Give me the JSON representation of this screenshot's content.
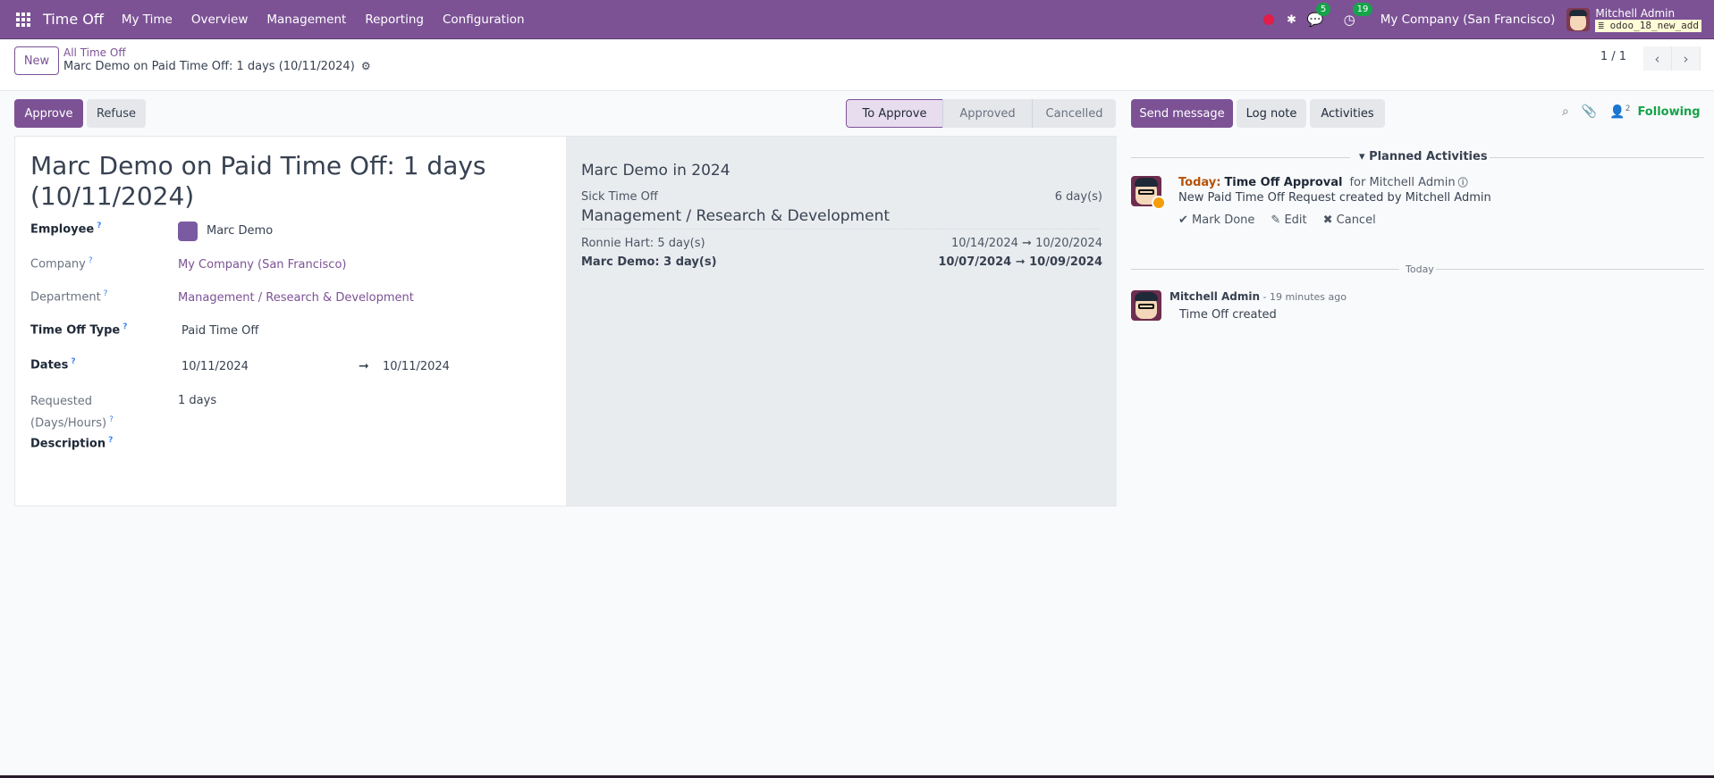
{
  "topbar": {
    "app_title": "Time Off",
    "menu": [
      "My Time",
      "Overview",
      "Management",
      "Reporting",
      "Configuration"
    ],
    "messages_badge": "5",
    "activities_badge": "19",
    "company": "My Company (San Francisco)",
    "user_name": "Mitchell Admin",
    "database": "odoo_18_new_add",
    "icons": {
      "apps": "apps-grid-icon",
      "record": "record-dot-icon",
      "debug": "bug-icon",
      "messages": "chat-icon",
      "activities": "clock-icon"
    }
  },
  "control": {
    "new_label": "New",
    "breadcrumb_parent": "All Time Off",
    "breadcrumb_current": "Marc Demo on Paid Time Off: 1 days (10/11/2024)",
    "pager": "1 / 1",
    "prev_icon": "‹",
    "next_icon": "›"
  },
  "actions": {
    "approve": "Approve",
    "refuse": "Refuse"
  },
  "statusbar": {
    "stages": [
      "To Approve",
      "Approved",
      "Cancelled"
    ],
    "active": "To Approve"
  },
  "form": {
    "title_line1": "Marc Demo on Paid Time Off: 1 days",
    "title_line2": "(10/11/2024)",
    "help_mark": "?",
    "fields": {
      "employee": {
        "label": "Employee",
        "value": "Marc Demo"
      },
      "company": {
        "label": "Company",
        "value": "My Company (San Francisco)"
      },
      "department": {
        "label": "Department",
        "value": "Management / Research & Development"
      },
      "time_off_type": {
        "label": "Time Off Type",
        "value": "Paid Time Off"
      },
      "dates": {
        "label": "Dates",
        "from": "10/11/2024",
        "to": "10/11/2024",
        "arrow": "➞"
      },
      "requested": {
        "label_line1": "Requested",
        "label_line2": "(Days/Hours)",
        "value": "1 days"
      },
      "description": {
        "label": "Description"
      }
    }
  },
  "summary": {
    "title": "Marc Demo in 2024",
    "allocations": [
      {
        "type": "Sick Time Off",
        "amount": "6 day(s)"
      }
    ],
    "department_title": "Management / Research & Development",
    "entries": [
      {
        "name": "Ronnie Hart: 5 day(s)",
        "from": "10/14/2024",
        "to": "10/20/2024",
        "bold": false
      },
      {
        "name": "Marc Demo: 3 day(s)",
        "from": "10/07/2024",
        "to": "10/09/2024",
        "bold": true
      }
    ],
    "arrow": "➞"
  },
  "chatter": {
    "send_message": "Send message",
    "log_note": "Log note",
    "activities": "Activities",
    "followers_count": "2",
    "following": "Following",
    "planned_title": "Planned Activities",
    "activity": {
      "due": "Today:",
      "name": "Time Off Approval",
      "assignee": "for Mitchell Admin",
      "description": "New Paid Time Off Request created by Mitchell Admin",
      "mark_done": "✔ Mark Done",
      "edit": "✎ Edit",
      "cancel": "✖ Cancel"
    },
    "date_separator": "Today",
    "message": {
      "author": "Mitchell Admin",
      "time": " - 19 minutes ago",
      "body": "Time Off created"
    }
  }
}
